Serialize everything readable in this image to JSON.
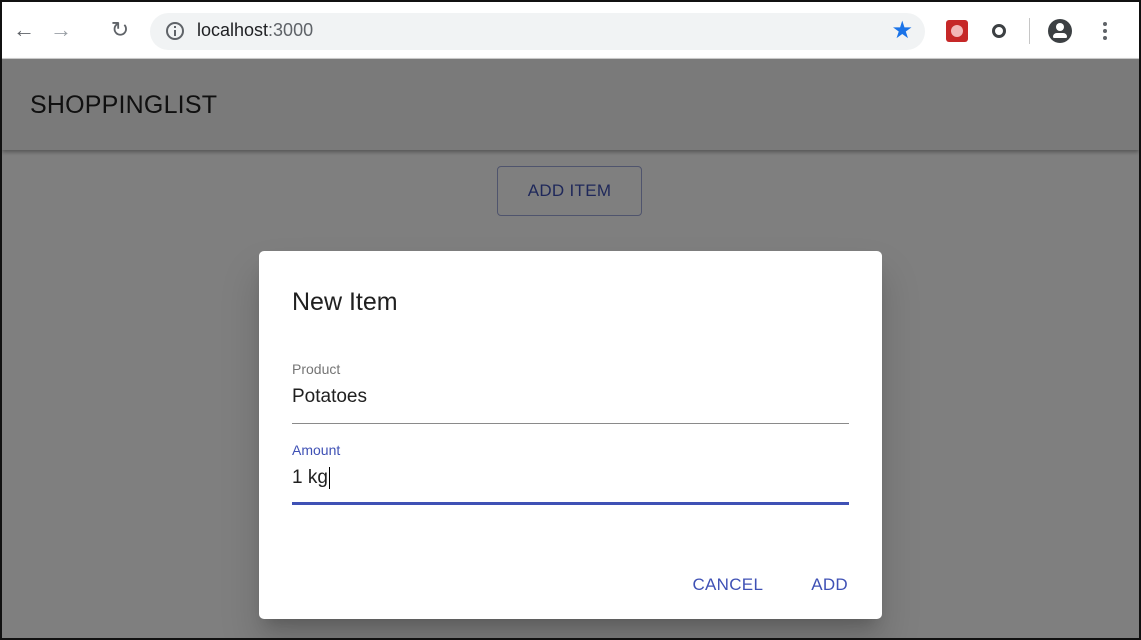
{
  "browser": {
    "url_host": "localhost",
    "url_port": ":3000",
    "icons": [
      "back-arrow-icon",
      "forward-arrow-icon",
      "reload-icon",
      "info-icon",
      "bookmark-star-icon",
      "extension-icon",
      "extension-globe-icon",
      "account-icon",
      "menu-icon"
    ],
    "accent_color": "#1a73e8"
  },
  "app": {
    "title": "SHOPPINGLIST",
    "add_item_label": "ADD ITEM",
    "primary_color": "#3f51b5"
  },
  "dialog": {
    "title": "New Item",
    "product": {
      "label": "Product",
      "value": "Potatoes"
    },
    "amount": {
      "label": "Amount",
      "value": "1 kg"
    },
    "cancel_label": "CANCEL",
    "add_label": "ADD"
  }
}
